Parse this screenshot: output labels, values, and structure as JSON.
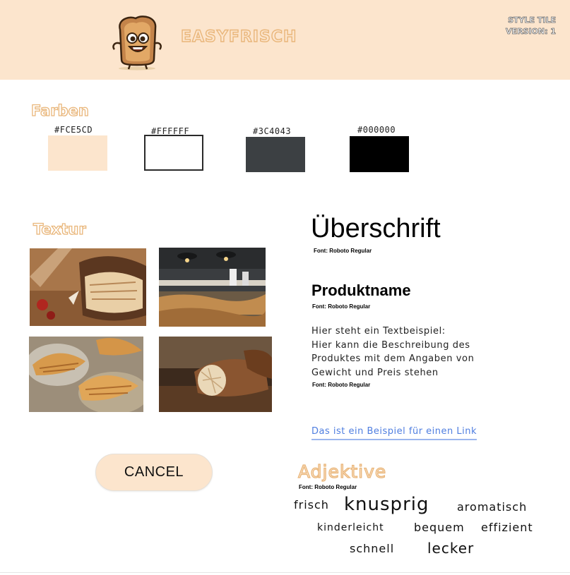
{
  "header": {
    "brand": "EASYFRISCH",
    "style_tile": "STYLE TILE",
    "version": "VERSION: 1"
  },
  "colors_section": {
    "title": "Farben",
    "swatches": [
      {
        "hex": "#FCE5CD",
        "label": "#FCE5CD"
      },
      {
        "hex": "#FFFFFF",
        "label": "#FFFFFF"
      },
      {
        "hex": "#3C4043",
        "label": "#3C4043"
      },
      {
        "hex": "#000000",
        "label": "#000000"
      }
    ]
  },
  "texture_section": {
    "title": "Textur",
    "images": [
      "bread-loaf-photo",
      "bakery-counter-photo",
      "croissants-photo",
      "bread-closeup-photo"
    ]
  },
  "typography": {
    "heading": "Überschrift",
    "heading_font": "Font: Roboto Regular",
    "product_name": "Produktname",
    "product_font": "Font: Roboto Regular",
    "body_lines": [
      "Hier steht ein Textbeispiel:",
      "Hier kann die Beschreibung des",
      "Produktes mit dem Angaben von",
      "Gewicht und Preis stehen"
    ],
    "body_font": "Font: Roboto Regular",
    "link_text": "Das ist ein Beispiel für einen Link"
  },
  "buttons": {
    "cancel": "CANCEL"
  },
  "adjectives": {
    "title": "Adjektive",
    "font": "Font: Roboto Regular",
    "words": [
      "frisch",
      "knusprig",
      "aromatisch",
      "kinderleicht",
      "bequem",
      "effizient",
      "schnell",
      "lecker"
    ]
  },
  "theme": {
    "accent": "#FCE5CD",
    "accent_outline": "#E9B67A",
    "link": "#4f7ee0"
  }
}
